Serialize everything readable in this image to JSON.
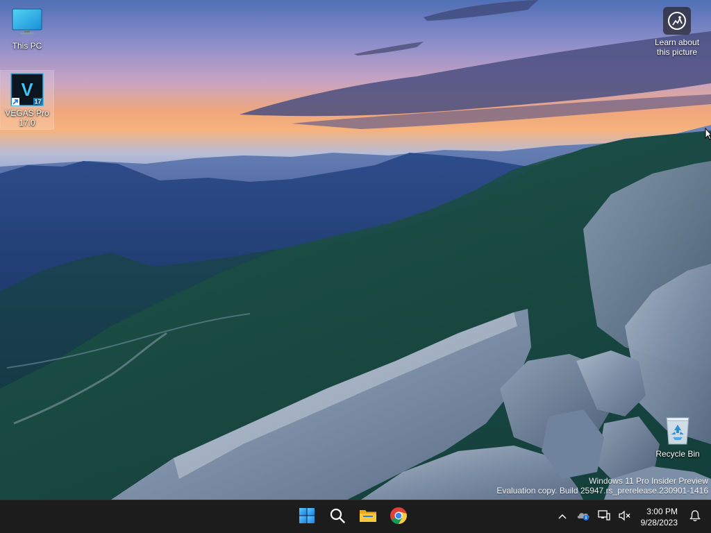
{
  "desktop": {
    "icons": [
      {
        "label": "This PC",
        "icon": "monitor-icon"
      },
      {
        "label": "VEGAS Pro 17.0",
        "icon": "vegas-pro-icon",
        "badge": "17",
        "glyph": "V"
      },
      {
        "label": "Recycle Bin",
        "icon": "recycle-bin-icon"
      }
    ],
    "spotlight": {
      "label_line1": "Learn about",
      "label_line2": "this picture",
      "icon": "camera-icon"
    }
  },
  "watermark": {
    "line1": "Windows 11 Pro Insider Preview",
    "line2": "Evaluation copy. Build 25947.rs_prerelease.230901-1416"
  },
  "taskbar": {
    "apps": [
      {
        "name": "Start",
        "icon": "windows-start-icon"
      },
      {
        "name": "Search",
        "icon": "search-icon"
      },
      {
        "name": "File Explorer",
        "icon": "folder-icon"
      },
      {
        "name": "Google Chrome",
        "icon": "chrome-icon"
      }
    ],
    "tray": {
      "icons": [
        "chevron-up-icon",
        "onedrive-icon",
        "network-icon",
        "volume-muted-icon",
        "notification-bell-icon"
      ],
      "time": "3:00 PM",
      "date": "9/28/2023"
    },
    "colors": {
      "background": "#1c1c1c",
      "accent": "#1a8ef0"
    }
  }
}
